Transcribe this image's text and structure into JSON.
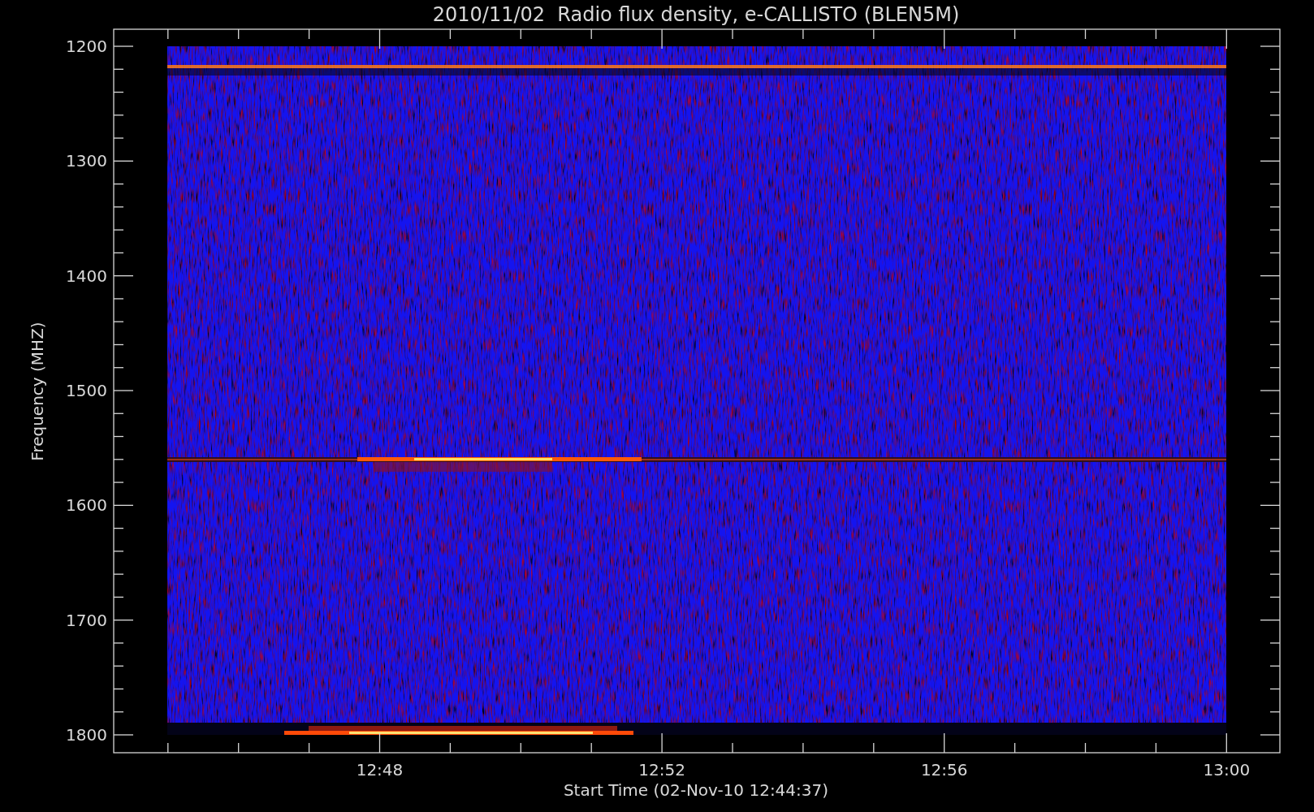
{
  "title": "2010/11/02  Radio flux density, e-CALLISTO (BLEN5M)",
  "plot": {
    "ylabel": "Frequency (MHZ)",
    "xlabel": "Start Time (02-Nov-10 12:44:37)",
    "yticks": [
      "1200",
      "1300",
      "1400",
      "1500",
      "1600",
      "1700",
      "1800"
    ],
    "xticks": [
      "12:48",
      "12:52",
      "12:56",
      "13:00"
    ]
  }
}
